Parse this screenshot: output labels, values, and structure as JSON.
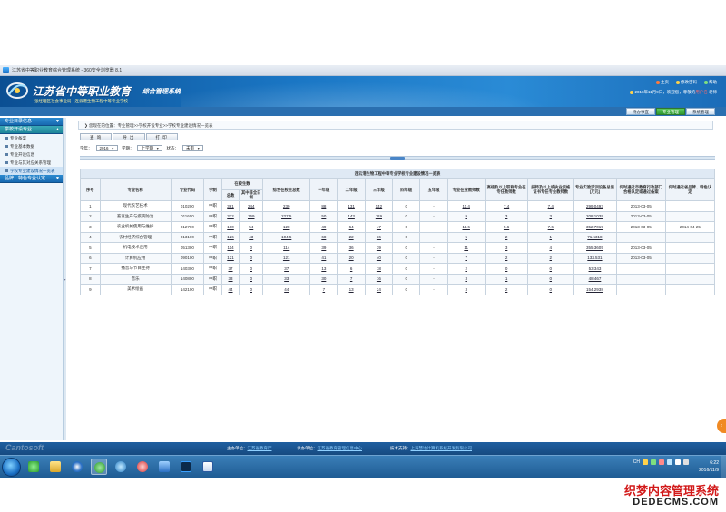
{
  "window": {
    "title": "江苏省中等职业教育综合管理系统 - 360安全浏览器 8.1"
  },
  "header": {
    "title_main": "江苏省中等职业教育",
    "title_small": "综合管理系统",
    "subtitle": "张经理区社会事业局 - 连云港生物工程中等专业学校",
    "links": [
      "主页",
      "修改密码",
      "帮助"
    ],
    "info": "2016年11月9日，欢迎您，尊敬的",
    "info_role": "用户名",
    "info_suffix": "老师"
  },
  "topnav": [
    "待办事宜",
    "专业管理",
    "系统管理"
  ],
  "topnav_active": 1,
  "sidebar": {
    "groups": [
      {
        "label": "专业目录信息",
        "items": []
      },
      {
        "label": "学校开设专业",
        "items": [
          "专业备案",
          "专业基本数据",
          "专业开设信息",
          "专业与其对应关系管理",
          "学校专业建设情况一览表"
        ]
      },
      {
        "label": "品牌、特色专业认定",
        "items": []
      }
    ],
    "active_item": "学校专业建设情况一览表"
  },
  "breadcrumb": "您现在的位置：专业管理>>学校开设专业>>学校专业建设情况一览表",
  "buttons": [
    "查 询",
    "导 出",
    "打 印"
  ],
  "filters": {
    "year_label": "学年：",
    "year_value": "2016",
    "term_label": "学期：",
    "term_value": "上学期",
    "status_label": "状态：",
    "status_value": "未审"
  },
  "table": {
    "caption": "连云港生物工程中等专业学校专业建设情况一览表",
    "headers": {
      "seq": "序号",
      "name": "专业名称",
      "code": "专业代码",
      "system": "学制",
      "enrolled": "在校生数",
      "enrolled_total": "总数",
      "enrolled_full": "其中非全日制",
      "comprehensive": "综合在校生总数",
      "g1": "一年级",
      "g2": "二年级",
      "g3": "三年级",
      "g4": "四年级",
      "g5": "五年级",
      "teachers": "专业在业教师数",
      "senior": "高级及以上职称专业在专任教师数",
      "dual": "技师及以上或执业资格证书专任专业教师数",
      "equip": "专业实验实训设备总值(万元)",
      "provincial": "何时通过市教育行政部门合格认定或通过备案",
      "brand": "何时通过省品牌、特色认定"
    },
    "rows": [
      [
        "1",
        "现代农艺技术",
        "010200",
        "中职",
        "361",
        "244",
        "239",
        "88",
        "131",
        "142",
        "0",
        "-",
        "11.4",
        "7.4",
        "7.4",
        "299.0493",
        "2013-03-05",
        ""
      ],
      [
        "2",
        "畜禽生产与疾病防治",
        "011600",
        "中职",
        "312",
        "169",
        "227.5",
        "50",
        "143",
        "119",
        "0",
        "-",
        "9",
        "3",
        "3",
        "208.1039",
        "2013-03-05",
        ""
      ],
      [
        "3",
        "农业机械使用与维护",
        "012700",
        "中职",
        "160",
        "54",
        "128",
        "49",
        "64",
        "47",
        "0",
        "-",
        "11.6",
        "5.6",
        "7.6",
        "352.7019",
        "2013-03-05",
        "2014-04-25"
      ],
      [
        "4",
        "农村经济综合管理",
        "013100",
        "中职",
        "126",
        "43",
        "104.5",
        "68",
        "22",
        "36",
        "0",
        "-",
        "5",
        "2",
        "1",
        "71.5318",
        "",
        ""
      ],
      [
        "5",
        "机电技术应用",
        "051300",
        "中职",
        "114",
        "0",
        "114",
        "39",
        "36",
        "39",
        "0",
        "-",
        "11",
        "3",
        "4",
        "355.3605",
        "2013-03-05",
        ""
      ],
      [
        "6",
        "计算机应用",
        "090100",
        "中职",
        "121",
        "0",
        "121",
        "41",
        "20",
        "40",
        "0",
        "-",
        "7",
        "2",
        "2",
        "132.531",
        "2013-03-05",
        ""
      ],
      [
        "7",
        "播音与节目主持",
        "140300",
        "中职",
        "37",
        "0",
        "37",
        "13",
        "6",
        "18",
        "0",
        "-",
        "2",
        "0",
        "0",
        "53.343",
        "",
        ""
      ],
      [
        "8",
        "音乐",
        "140800",
        "中职",
        "33",
        "0",
        "33",
        "30",
        "7",
        "16",
        "0",
        "-",
        "3",
        "1",
        "0",
        "48.467",
        "",
        ""
      ],
      [
        "9",
        "美术绘画",
        "142100",
        "中职",
        "44",
        "0",
        "44",
        "7",
        "13",
        "24",
        "0",
        "-",
        "3",
        "2",
        "0",
        "154.2938",
        "",
        ""
      ]
    ]
  },
  "footer": {
    "brand": "Cantosoft",
    "host_label": "主办单位：",
    "host": "江苏省教育厅",
    "org_label": "承办单位：",
    "org": "江苏省教育管理信息中心",
    "tech_label": "技术支持：",
    "tech": "上海慧达计算机系统开发有限公司"
  },
  "taskbar": {
    "time": "6:22",
    "date": "2016/11/9",
    "tray_lang": "CH"
  },
  "watermark": {
    "line1": "织梦内容管理系统",
    "line2": "DEDECMS.COM"
  },
  "colors": {
    "header_blue": "#1a76c4",
    "nav_active_green": "#2e9a2e",
    "sidebar_group": "#1769b0",
    "watermark_red": "#d21a1a"
  }
}
